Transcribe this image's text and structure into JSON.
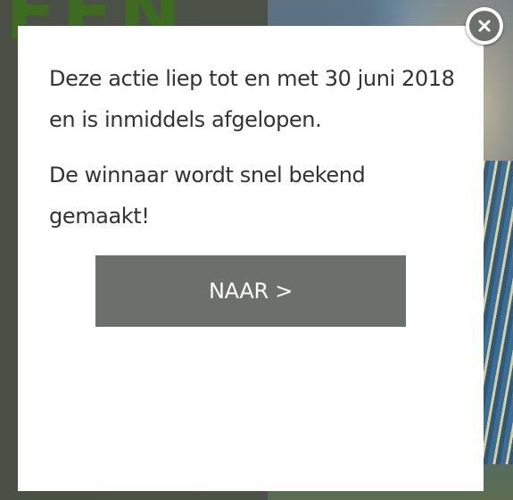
{
  "background": {
    "heading_fragment": "EEN"
  },
  "modal": {
    "message_line_1": "Deze actie liep tot en met 30 juni 2018 en is inmiddels afgelopen.",
    "message_line_2": "De winnaar wordt snel bekend gemaakt!",
    "button_label": "NAAR >",
    "close_icon": "close-icon"
  },
  "colors": {
    "modal_background": "#ffffff",
    "button_background": "#6b706d",
    "button_text": "#ffffff",
    "text": "#333333",
    "close_icon_background": "#6b706d",
    "backdrop_heading": "#3d6b1f"
  }
}
